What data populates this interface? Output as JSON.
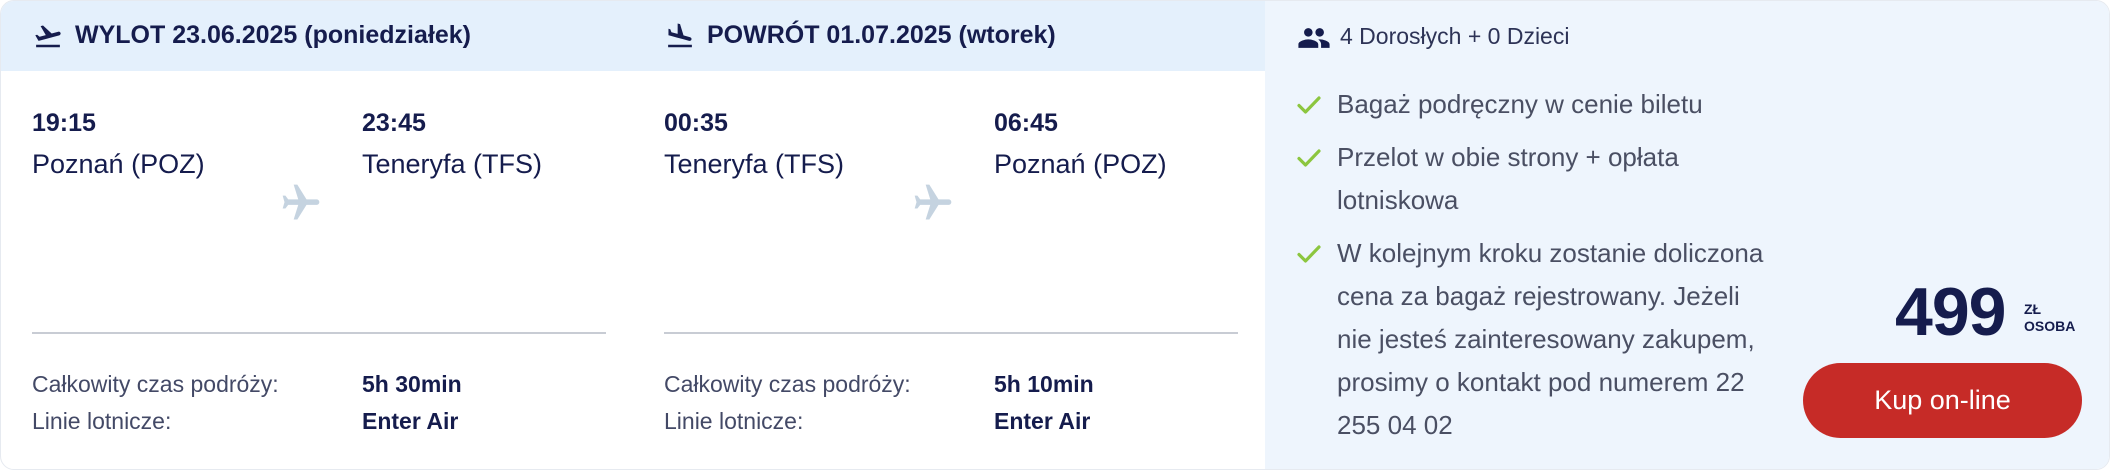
{
  "outbound": {
    "header": "WYLOT 23.06.2025 (poniedziałek)",
    "dep_time": "19:15",
    "arr_time": "23:45",
    "dep_city": "Poznań (POZ)",
    "arr_city": "Teneryfa (TFS)",
    "duration_label": "Całkowity czas podróży:",
    "duration": "5h 30min",
    "airline_label": "Linie lotnicze:",
    "airline": "Enter Air",
    "icon": "plane-takeoff-icon"
  },
  "return": {
    "header": "POWRÓT 01.07.2025 (wtorek)",
    "dep_time": "00:35",
    "arr_time": "06:45",
    "dep_city": "Teneryfa (TFS)",
    "arr_city": "Poznań (POZ)",
    "duration_label": "Całkowity czas podróży:",
    "duration": "5h 10min",
    "airline_label": "Linie lotnicze:",
    "airline": "Enter Air",
    "icon": "plane-landing-icon"
  },
  "passengers": "4 Dorosłych + 0 Dzieci",
  "features": [
    "Bagaż podręczny w cenie biletu",
    "Przelot w obie strony + opłata lotniskowa",
    "W kolejnym kroku zostanie doliczona cena za bagaż rejestrowany. Jeżeli nie jesteś zainteresowany zakupem, prosimy o kontakt pod numerem 22 255 04 02"
  ],
  "price": {
    "amount": "499",
    "currency": "ZŁ",
    "per": "OSOBA"
  },
  "buy_label": "Kup on-line",
  "colors": {
    "header_bg": "#e4f0fc",
    "side_bg": "#eef5fd",
    "text_dark": "#151c4d",
    "check_green": "#8cc63f",
    "button_red": "#c62b27",
    "plane_grey": "#c5d3e0"
  }
}
